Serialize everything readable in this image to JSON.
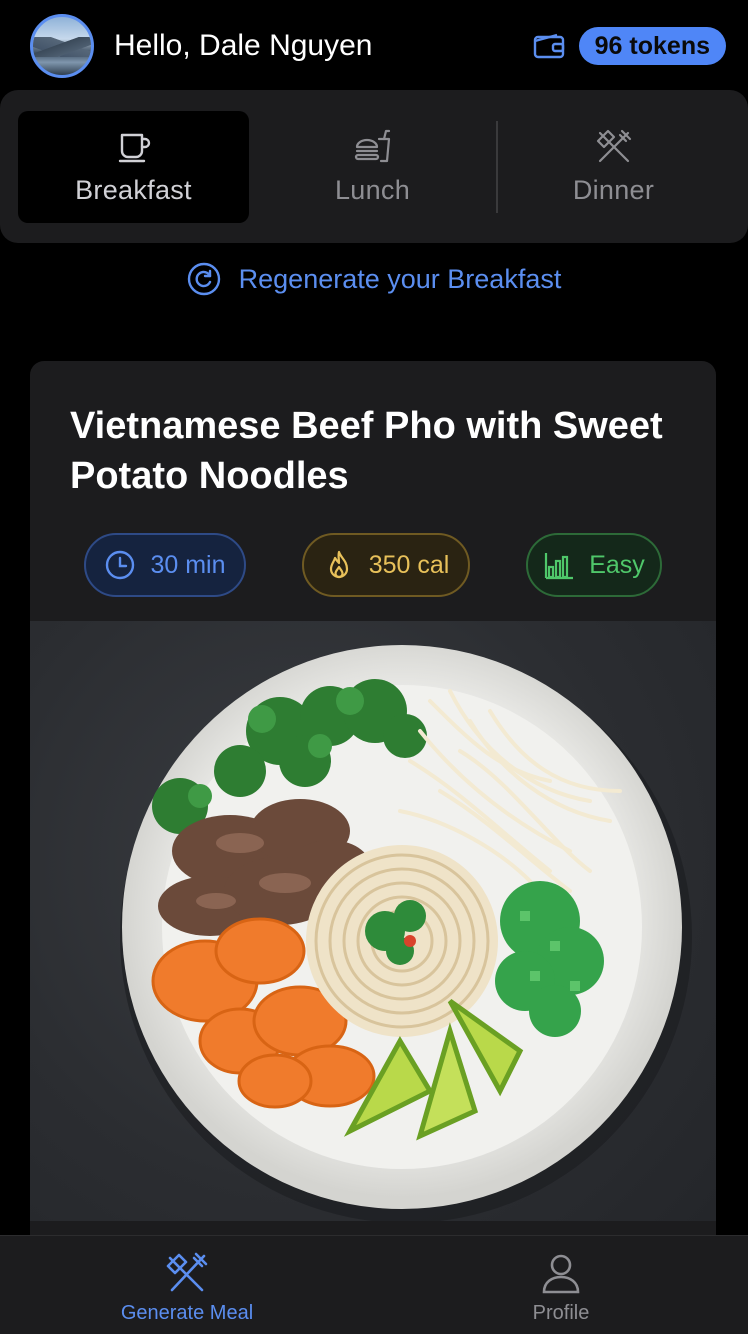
{
  "header": {
    "greeting": "Hello, Dale Nguyen",
    "tokens": "96 tokens",
    "avatar_icon": "user-avatar",
    "wallet_icon": "wallet-icon"
  },
  "meal_tabs": {
    "active": "Breakfast",
    "items": [
      {
        "label": "Breakfast",
        "icon": "coffee-cup-icon"
      },
      {
        "label": "Lunch",
        "icon": "burger-drink-icon"
      },
      {
        "label": "Dinner",
        "icon": "fork-knife-icon"
      }
    ]
  },
  "regenerate": {
    "label": "Regenerate your Breakfast",
    "icon": "refresh-icon"
  },
  "recipe": {
    "title": "Vietnamese Beef Pho with Sweet Potato Noodles",
    "time": "30 min",
    "calories": "350 cal",
    "difficulty": "Easy",
    "image_alt": "Pho bowl with beef, noodles, sweet potato, bean sprouts, lime and herbs"
  },
  "bottom_nav": {
    "generate_label": "Generate Meal",
    "profile_label": "Profile"
  },
  "colors": {
    "accent": "#4f86f7",
    "time": "#5b8ef0",
    "calories": "#e8c15a",
    "difficulty": "#4fc76a"
  }
}
